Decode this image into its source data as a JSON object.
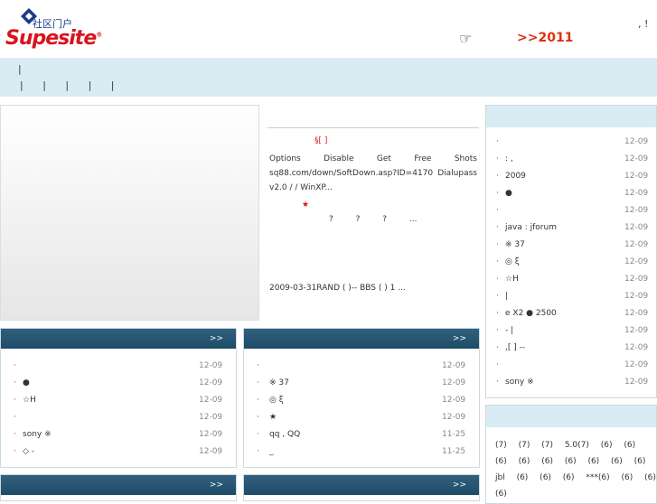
{
  "header": {
    "logo_top": "社区门户",
    "logo_main": "Supesite",
    "logo_mark": "®",
    "promo_icon": "pointing-hand-icon",
    "promo_link": ">>2011",
    "top_misc": ",   !"
  },
  "nav": {
    "row1": "|",
    "row2": "|  |  |  |  |"
  },
  "feature": {
    "title": "§[ ]",
    "body": "Options Disable Get Free Shots sq88.com/down/SoftDown.asp?ID=4170    Dialupass v2.0          /   /       WinXP...",
    "star": "★",
    "questions": "?  ?  ?  ...",
    "date_text": "2009-03-31RAND            (   )-- BBS        (   )     1       ..."
  },
  "box_left": {
    "more": ">>",
    "items": [
      {
        "text": "",
        "date": "12-09"
      },
      {
        "text": "●",
        "date": "12-09"
      },
      {
        "text": "☆H",
        "date": "12-09"
      },
      {
        "text": "",
        "date": "12-09"
      },
      {
        "text": "sony      ※",
        "date": "12-09"
      },
      {
        "text": "◇   -",
        "date": "12-09"
      }
    ]
  },
  "box_mid": {
    "more": ">>",
    "items": [
      {
        "text": "",
        "date": "12-09"
      },
      {
        "text": "※      37",
        "date": "12-09"
      },
      {
        "text": "◎ ξ",
        "date": "12-09"
      },
      {
        "text": "★",
        "date": "12-09"
      },
      {
        "text": "qq   ,  QQ",
        "date": "11-25"
      },
      {
        "text": "_",
        "date": "11-25"
      }
    ]
  },
  "box_left2": {
    "more": ">>"
  },
  "box_mid2": {
    "more": ">>"
  },
  "box_right": {
    "items": [
      {
        "text": "",
        "date": "12-09"
      },
      {
        "text": ":     ,",
        "date": "12-09"
      },
      {
        "text": "2009",
        "date": "12-09"
      },
      {
        "text": "●",
        "date": "12-09"
      },
      {
        "text": "",
        "date": "12-09"
      },
      {
        "text": "java    :    jforum",
        "date": "12-09"
      },
      {
        "text": "※      37",
        "date": "12-09"
      },
      {
        "text": "◎ ξ",
        "date": "12-09"
      },
      {
        "text": "☆H",
        "date": "12-09"
      },
      {
        "text": "|",
        "date": "12-09"
      },
      {
        "text": "e  X2   ●    2500",
        "date": "12-09"
      },
      {
        "text": "-          |",
        "date": "12-09"
      },
      {
        "text": ",[ ]      --",
        "date": "12-09"
      },
      {
        "text": "",
        "date": "12-09"
      },
      {
        "text": "sony      ※",
        "date": "12-09"
      }
    ]
  },
  "box_tags": {
    "text": "(7)  (7)  (7)  5.0(7)  (6)  (6)  (6)  (6)  (6)  (6)  (6)  (6)  (6)  jbl  (6)  (6)  (6)  ***(6)  (6)  (6)  (6)"
  },
  "colors": {
    "accent_red": "#d8141c",
    "nav_bg": "#d9ebf3",
    "box_header": "#2a5876"
  }
}
